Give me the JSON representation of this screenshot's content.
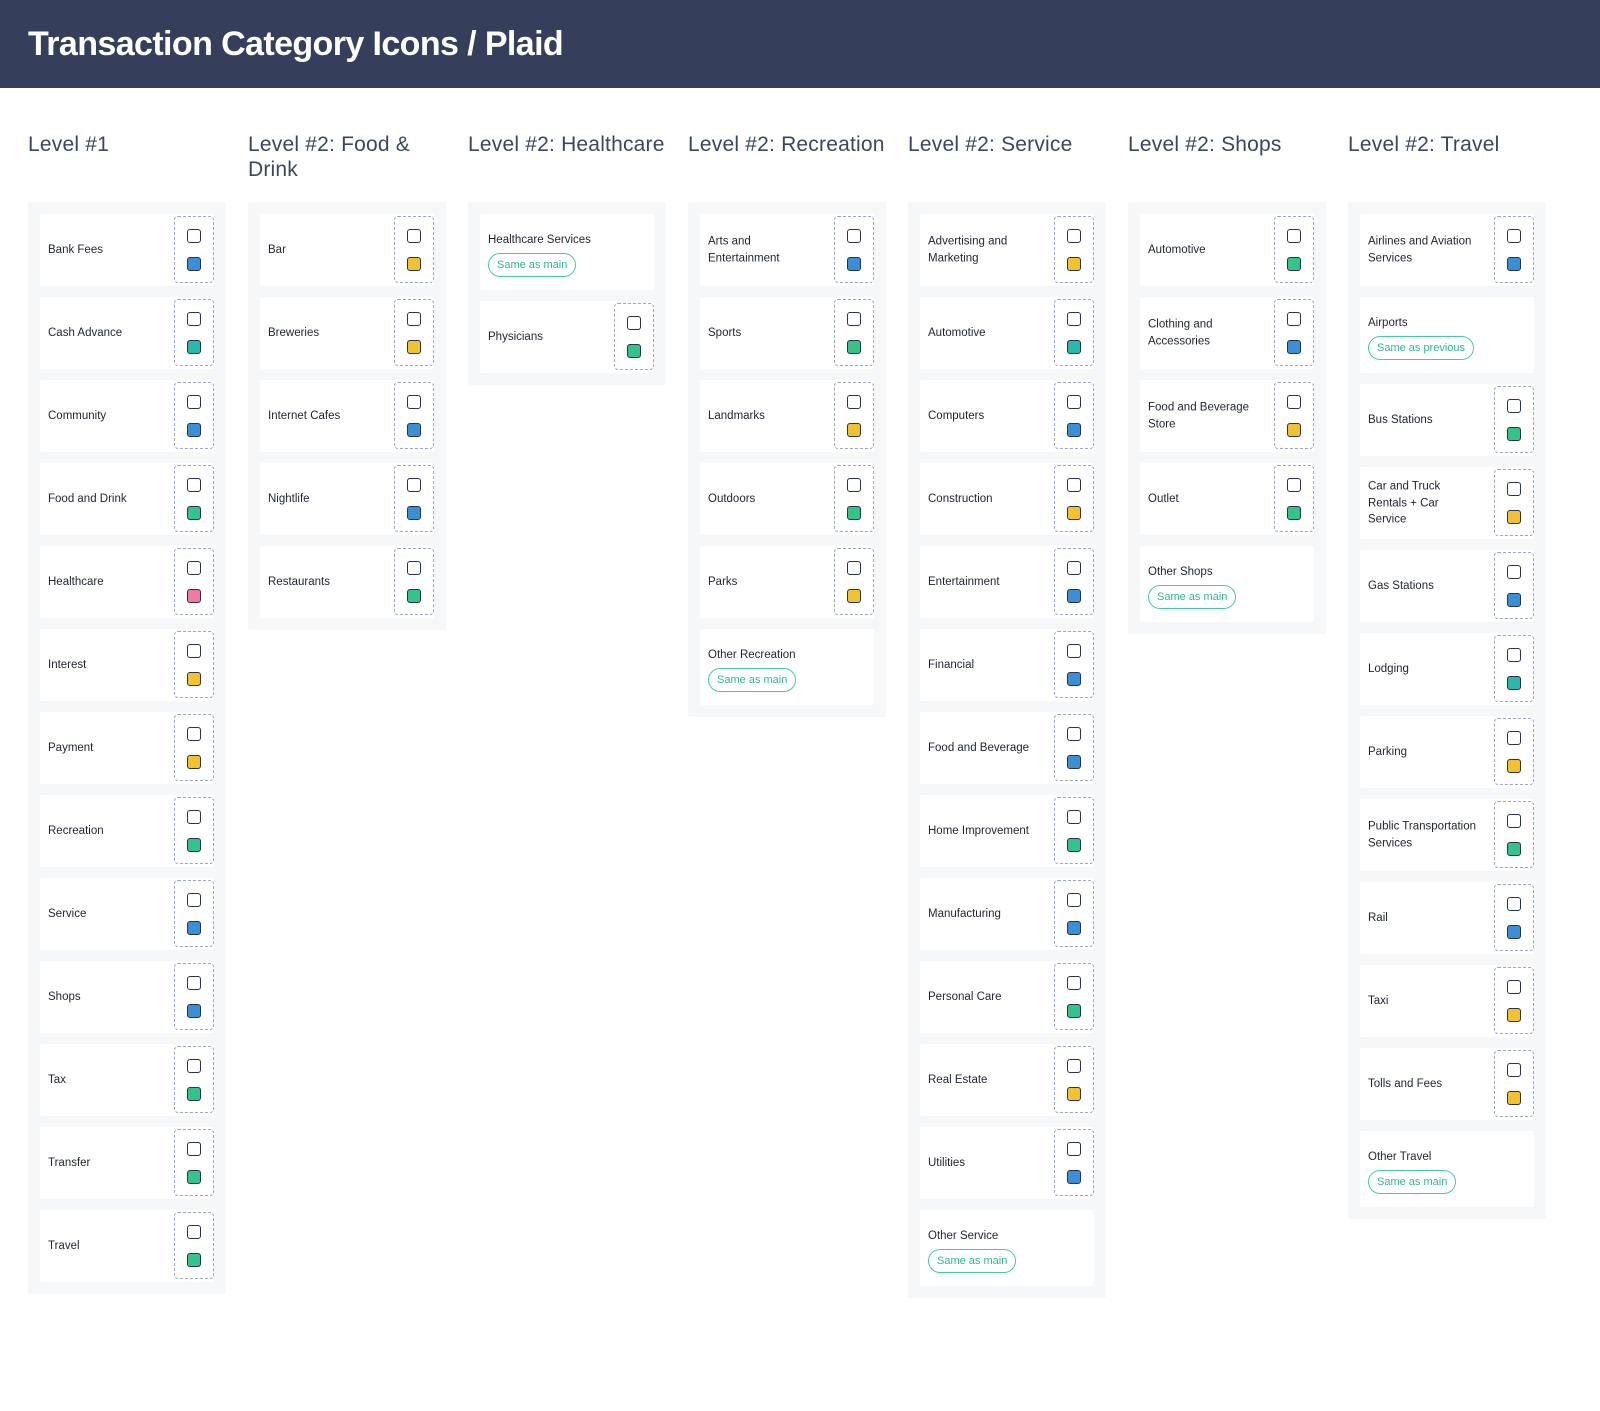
{
  "header": {
    "title": "Transaction Category Icons / Plaid"
  },
  "columns": [
    {
      "title": "Level #1",
      "items": [
        {
          "label": "Bank Fees",
          "icon": "bank-icon",
          "accent": "blue"
        },
        {
          "label": "Cash Advance",
          "icon": "cash-icon",
          "accent": "teal"
        },
        {
          "label": "Community",
          "icon": "people-icon",
          "accent": "blue"
        },
        {
          "label": "Food and Drink",
          "icon": "bowl-icon",
          "accent": "green"
        },
        {
          "label": "Healthcare",
          "icon": "heart-icon",
          "accent": "pink"
        },
        {
          "label": "Interest",
          "icon": "interest-icon",
          "accent": "yellow"
        },
        {
          "label": "Payment",
          "icon": "coin-icon",
          "accent": "yellow"
        },
        {
          "label": "Recreation",
          "icon": "leaf-icon",
          "accent": "green"
        },
        {
          "label": "Service",
          "icon": "user-circle-icon",
          "accent": "blue"
        },
        {
          "label": "Shops",
          "icon": "shopping-bag-icon",
          "accent": "blue"
        },
        {
          "label": "Tax",
          "icon": "money-bag-icon",
          "accent": "green"
        },
        {
          "label": "Transfer",
          "icon": "transfer-arrows-icon",
          "accent": "green"
        },
        {
          "label": "Travel",
          "icon": "route-icon",
          "accent": "green"
        }
      ]
    },
    {
      "title": "Level #2: Food & Drink",
      "items": [
        {
          "label": "Bar",
          "icon": "cocktail-icon",
          "accent": "yellow"
        },
        {
          "label": "Breweries",
          "icon": "beer-icon",
          "accent": "yellow"
        },
        {
          "label": "Internet Cafes",
          "icon": "coffee-icon",
          "accent": "blue"
        },
        {
          "label": "Nightlife",
          "icon": "disco-ball-icon",
          "accent": "blue"
        },
        {
          "label": "Restaurants",
          "icon": "cloche-icon",
          "accent": "green"
        }
      ]
    },
    {
      "title": "Level #2: Healthcare",
      "items": [
        {
          "label": "Healthcare Services",
          "badge": "Same as main"
        },
        {
          "label": "Physicians",
          "icon": "stethoscope-icon",
          "accent": "green"
        }
      ]
    },
    {
      "title": "Level #2: Recreation",
      "items": [
        {
          "label": "Arts and Entertainment",
          "icon": "easel-icon",
          "accent": "blue"
        },
        {
          "label": "Sports",
          "icon": "ball-icon",
          "accent": "green"
        },
        {
          "label": "Landmarks",
          "icon": "tower-icon",
          "accent": "yellow"
        },
        {
          "label": "Outdoors",
          "icon": "tree-icon",
          "accent": "green"
        },
        {
          "label": "Parks",
          "icon": "park-icon",
          "accent": "yellow"
        },
        {
          "label": "Other Recreation",
          "badge": "Same as main"
        }
      ]
    },
    {
      "title": "Level #2: Service",
      "items": [
        {
          "label": "Advertising and Marketing",
          "icon": "megaphone-icon",
          "accent": "yellow"
        },
        {
          "label": "Automotive",
          "icon": "engine-icon",
          "accent": "teal"
        },
        {
          "label": "Computers",
          "icon": "computer-icon",
          "accent": "blue"
        },
        {
          "label": "Construction",
          "icon": "building-crane-icon",
          "accent": "yellow"
        },
        {
          "label": "Entertainment",
          "icon": "play-screen-icon",
          "accent": "blue"
        },
        {
          "label": "Financial",
          "icon": "piggy-icon",
          "accent": "blue"
        },
        {
          "label": "Food and Beverage",
          "icon": "grid-food-icon",
          "accent": "blue"
        },
        {
          "label": "Home Improvement",
          "icon": "paint-roller-icon",
          "accent": "green"
        },
        {
          "label": "Manufacturing",
          "icon": "factory-icon",
          "accent": "blue"
        },
        {
          "label": "Personal Care",
          "icon": "face-icon",
          "accent": "green"
        },
        {
          "label": "Real Estate",
          "icon": "house-icon",
          "accent": "yellow"
        },
        {
          "label": "Utilities",
          "icon": "faucet-icon",
          "accent": "blue"
        },
        {
          "label": "Other Service",
          "badge": "Same as main"
        }
      ]
    },
    {
      "title": "Level #2: Shops",
      "items": [
        {
          "label": "Automotive",
          "icon": "car-icon",
          "accent": "green"
        },
        {
          "label": "Clothing and Accessories",
          "icon": "shirt-icon",
          "accent": "blue"
        },
        {
          "label": "Food and Beverage Store",
          "icon": "grocery-basket-icon",
          "accent": "yellow"
        },
        {
          "label": "Outlet",
          "icon": "storefront-icon",
          "accent": "green"
        },
        {
          "label": "Other Shops",
          "badge": "Same as main"
        }
      ]
    },
    {
      "title": "Level #2: Travel",
      "items": [
        {
          "label": "Airlines and Aviation Services",
          "icon": "airplane-icon",
          "accent": "blue"
        },
        {
          "label": "Airports",
          "badge": "Same as previous"
        },
        {
          "label": "Bus Stations",
          "icon": "bus-icon",
          "accent": "green"
        },
        {
          "label": "Car and Truck Rentals + Car Service",
          "icon": "car-rental-icon",
          "accent": "yellow"
        },
        {
          "label": "Gas Stations",
          "icon": "gas-pump-icon",
          "accent": "blue"
        },
        {
          "label": "Lodging",
          "icon": "bed-icon",
          "accent": "teal"
        },
        {
          "label": "Parking",
          "icon": "parking-icon",
          "accent": "yellow"
        },
        {
          "label": "Public Transportation Services",
          "icon": "tram-icon",
          "accent": "green"
        },
        {
          "label": "Rail",
          "icon": "train-icon",
          "accent": "blue"
        },
        {
          "label": "Taxi",
          "icon": "taxi-icon",
          "accent": "yellow"
        },
        {
          "label": "Tolls and Fees",
          "icon": "toll-gate-icon",
          "accent": "yellow"
        },
        {
          "label": "Other Travel",
          "badge": "Same as main"
        }
      ]
    }
  ]
}
